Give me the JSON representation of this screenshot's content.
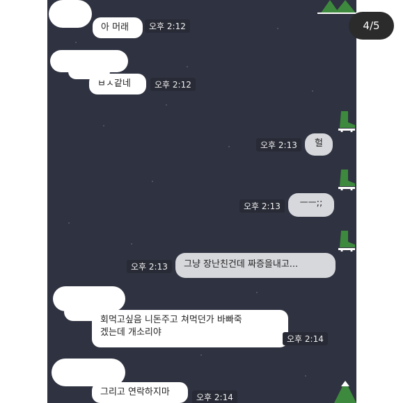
{
  "page_indicator": "4/5",
  "messages": [
    {
      "side": "left",
      "text": "아 머래",
      "time": "오후 2:12"
    },
    {
      "side": "left",
      "text": "ㅂㅅ같네",
      "time": "오후 2:12"
    },
    {
      "side": "right",
      "text": "헐",
      "time": "오후 2:13"
    },
    {
      "side": "right",
      "text": "ㅡㅡ;;",
      "time": "오후 2:13"
    },
    {
      "side": "right",
      "text": "그냥 장난친건데 짜증을내고...",
      "time": "오후 2:13"
    },
    {
      "side": "left",
      "text": "회먹고싶음 니돈주고 쳐먹던가 바빠죽\n겠는데 개소리야",
      "time": "오후 2:14"
    },
    {
      "side": "left",
      "text": "그리고 연락하지마",
      "time": "오후 2:14"
    }
  ],
  "colors": {
    "chat_bg": "#2f3240",
    "left_bubble": "#ffffff",
    "right_bubble": "#d7d8dc",
    "sticker_green": "#3d8a3e"
  },
  "icons": [
    "green-boot-sticker-icon",
    "pine-tree-icon"
  ]
}
